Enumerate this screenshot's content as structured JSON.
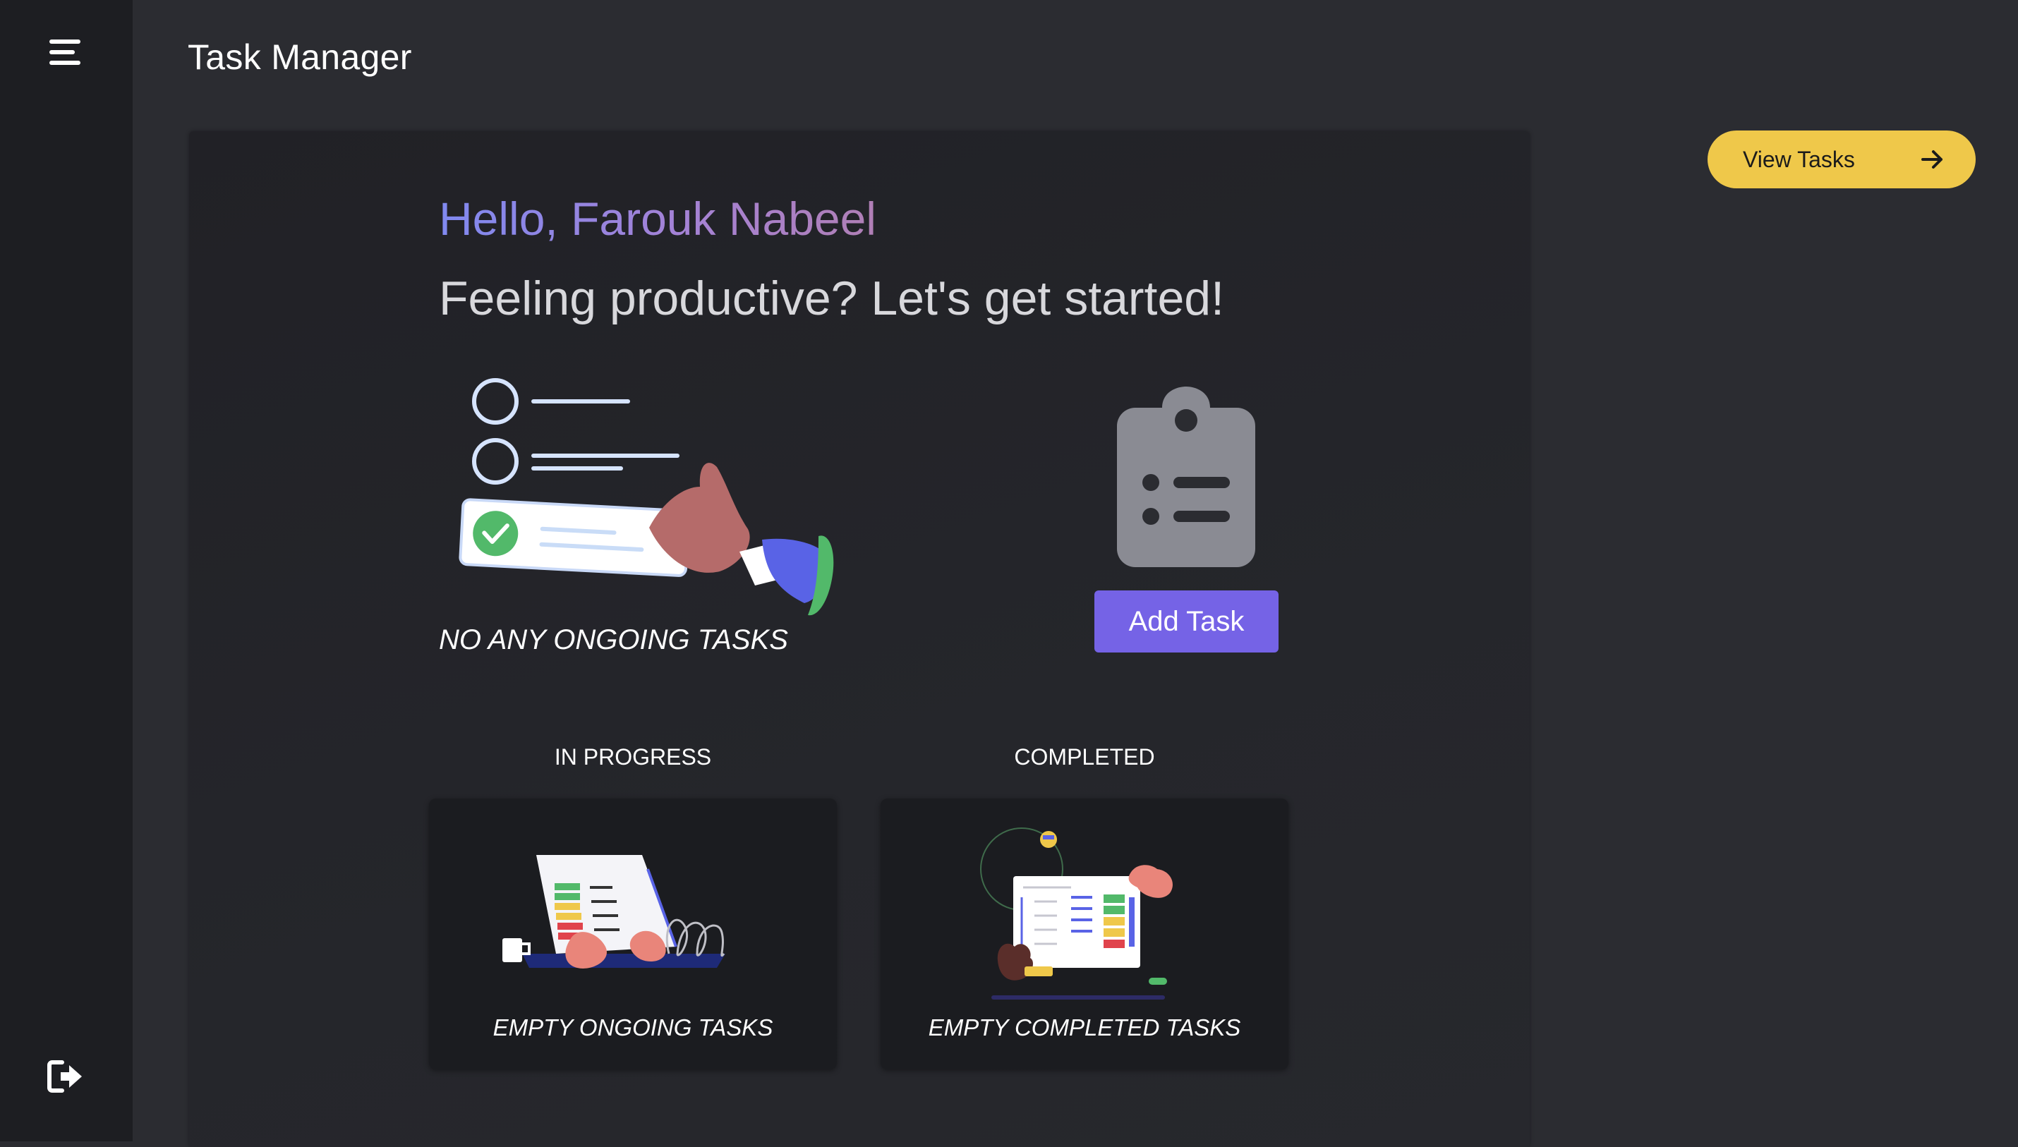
{
  "app": {
    "title": "Task Manager"
  },
  "header": {
    "view_tasks_label": "View Tasks"
  },
  "hero": {
    "greeting": "Hello, Farouk Nabeel",
    "subtitle": "Feeling productive? Let's get started!",
    "ongoing_status": "NO ANY ONGOING TASKS",
    "add_task_label": "Add Task"
  },
  "sections": {
    "in_progress": {
      "title": "IN PROGRESS",
      "empty_text": "EMPTY ONGOING TASKS"
    },
    "completed": {
      "title": "COMPLETED",
      "empty_text": "EMPTY COMPLETED TASKS"
    }
  },
  "icons": {
    "menu": "hamburger-menu-icon",
    "logout": "logout-icon",
    "arrow": "arrow-right-icon",
    "clipboard": "clipboard-list-icon"
  },
  "colors": {
    "accent_yellow": "#efc84a",
    "accent_purple": "#7563e6",
    "background": "#2b2c31",
    "sidebar": "#1d1e22"
  }
}
